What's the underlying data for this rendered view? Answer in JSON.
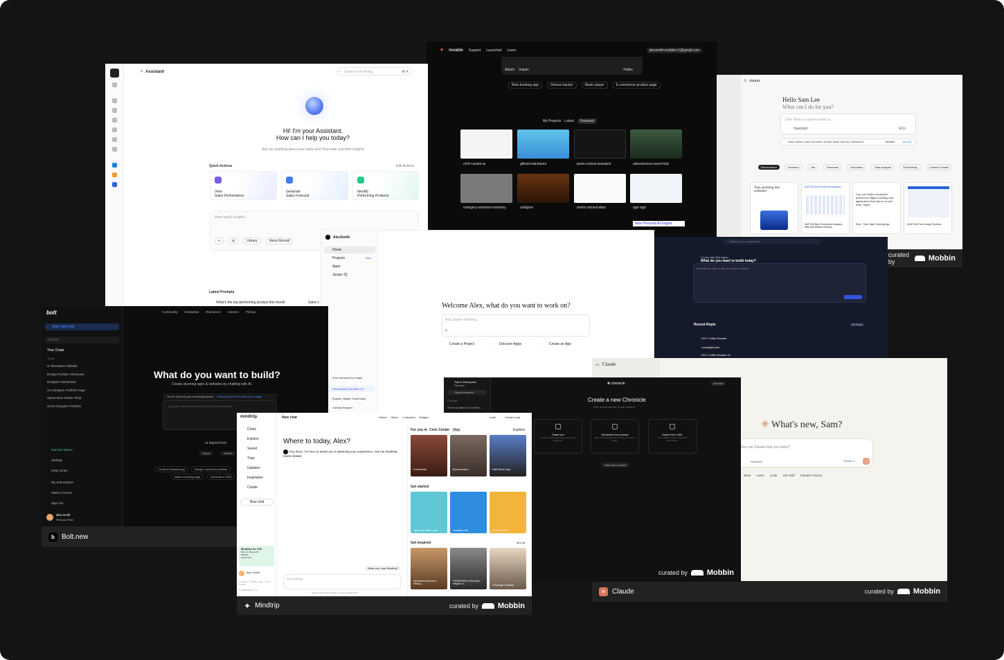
{
  "colors": {
    "frame": "#141414",
    "mobbin_bar": "#222222",
    "claude_accent": "#d97757",
    "bolt_blue": "#2d6de8"
  },
  "brand": {
    "mobbin": "Mobbin",
    "curated_by": "curated by",
    "curated_by_alt": "curated by"
  },
  "assistant": {
    "title": "Assistant",
    "search_placeholder": "Search everything...",
    "search_shortcut": "⌘ K",
    "heading": "Hi! I'm your Assistant.",
    "heading2": "How can I help you today?",
    "sub": "Ask me anything about your sales and I'll provide real-time insights",
    "quick_actions": "Quick Actions",
    "edit_actions": "Edit Actions",
    "cards": [
      {
        "l1": "View",
        "l2": "Sales Performance"
      },
      {
        "l1": "Generate",
        "l2": "Sales Forecast"
      },
      {
        "l1": "Identify",
        "l2": "Performing Products"
      }
    ],
    "input_placeholder": "Need quick insights...",
    "library": "Library",
    "voice": "Voice Record",
    "latest_prompts": "Latest Prompts",
    "prompt1": "What's the top-performing product this month",
    "prompt2": "Sales c"
  },
  "lovable": {
    "brand": "lovable",
    "nav": [
      "Support",
      "Launched",
      "Learn"
    ],
    "email": "alexsmith.mobbin+1@gmail.com",
    "attach": "Attach",
    "import": "Import",
    "public": "Public",
    "suggestions": [
      "Beta booking app",
      "Fitness tracker",
      "Music player",
      "E-commerce product page"
    ],
    "tabs": [
      "My Projects",
      "Latest",
      "Featured"
    ],
    "projects": [
      "chef-curator-ia",
      "github-hatchaven",
      "jarvis-voiced-assistant",
      "adventurous-resort-hub",
      "orangery-ventures-harmony",
      "undigmo",
      "metric-wizard-atlas",
      "agri-sign"
    ],
    "bottom_label": "New Personal AI Engine"
  },
  "manus": {
    "brand": "manus",
    "greeting": "Hello Sam Lee",
    "question": "What can I do for you?",
    "placeholder": "Give Manus a task to work on...",
    "standard": "Standard",
    "eco": "ECo",
    "suggestion": "Have Manus catch the plans at task starts and key milestones",
    "decline": "Decline",
    "accept": "Accept",
    "tabs": [
      "Recommend",
      "Featured",
      "Life",
      "Research",
      "Education",
      "Data Analysis",
      "Productivity",
      "Content Creator"
    ],
    "card1": "Turn anything into websites!",
    "card2_title": "S&P 500 Net Performers Analysis",
    "card3": "Can you build a beautiful interactive flight tracking web application that shows in real time, flight...",
    "card2_sub": "S&P 500 Best Performers Analysis - With and Without Outliers",
    "card3_sub": "Real - Time Flight Tracking App",
    "card4_sub": "MLB First Five Innings Predictor"
  },
  "jasper": {
    "user": "AlexSmith",
    "nav": [
      "Home",
      "Projects",
      "Apps",
      "Jasper IQ"
    ],
    "new_badge": "New",
    "welcome": "Welcome Alex, what do you want to work on?",
    "placeholder": "Ask Jasper anything...",
    "actions": [
      "Create a Project",
      "Discover Apps",
      "Create an App"
    ],
    "bottom": [
      "Free trial ends in 4 days",
      "Onboarding Checklist 0/4",
      "Explore Jasper Community",
      "Contact Support"
    ]
  },
  "boltdev": {
    "header": "Create with Bolt Agent",
    "question": "What do you want to build today?",
    "placeholder": "Describe an app or site you want to create...",
    "recent": "Recent Repls",
    "all_repls": "All Repls",
    "repls": [
      "NYC Coffee Roaster",
      "LandingRouter",
      "NYC Coffee Roaster v2"
    ],
    "search": "Search & run commands"
  },
  "bolt": {
    "brand": "bolt",
    "start_chat": "Start new chat",
    "search": "Search",
    "your_chats": "Your Chats",
    "today": "Today",
    "chats": [
      "UI Illustration Website",
      "Design Portfolio Showcase",
      "Designer Dashboard",
      "UX Designer Portfolio Page",
      "SpiceHome Online Shop",
      "UI/UX Designer Portfolio"
    ],
    "nav": [
      "Community",
      "Enterprise",
      "Resources",
      "Careers",
      "Pricing"
    ],
    "heading": "What do you want to build?",
    "sub": "Create stunning apps & websites by chatting with AI.",
    "tokens": "You've used all your remaining tokens.",
    "upgrade": "Subscribe to Pro for 66x more usage",
    "placeholder": "Type your idea and we'll bring it to life (or /command)",
    "import": "or import from",
    "figma": "Figma",
    "github": "GitHub",
    "pills": [
      "Create a financial app",
      "Design a directory website",
      "Make a landing page",
      "Generate a CRM"
    ],
    "menu": [
      "Get free tokens",
      "Settings",
      "Help Center",
      "My Subscription",
      "Select Account",
      "Sign Out"
    ],
    "user": "alex-smith",
    "plan": "Personal Plan",
    "caption": "Bolt.new"
  },
  "mindtrip": {
    "brand": "mindtrip.",
    "new_chat": "New chat",
    "nav": [
      "Chats",
      "Explore",
      "Saved",
      "Trips",
      "Updates",
      "Inspiration",
      "Create"
    ],
    "new_chat_btn": "New chat",
    "filters": [
      "Where",
      "When",
      "2 travelers",
      "Budget"
    ],
    "invite": "Invite",
    "create_trip": "Create a trip",
    "heading": "Where to today, Alex?",
    "message": "Hey there, I'm here to assist you in planning your experience. Ask me anything travel related.",
    "placeholder": "Ask anything...",
    "ask_suggest": "What can I ask Mindtrip?",
    "footer": "Mindtrip can make mistakes. Check important info.",
    "for_you": "For you in",
    "city": "Civic Center",
    "map": "Map",
    "explore": "Explore",
    "get_started": "Get started",
    "get_inspired": "Get inspired",
    "see_all": "See all",
    "places": [
      "Frenchette",
      "Bonaventure",
      "Half Moon Bay"
    ],
    "started": [
      "Take our travel quiz",
      "Create a trip",
      "Creator tools"
    ],
    "inspired": [
      "Marrakech Adventure, History,...",
      "FIREWORKS in Brooklyn Heights in...",
      "A Portugal Getaway"
    ],
    "ios_title": "Mindtrip for iOS",
    "ios_sub": "Plan on the go with Mindtrip",
    "learn_more": "Learn more",
    "user": "Alex Smith",
    "links": "Company · Contact · Help · Terms · Privacy",
    "copyright": "© 2025 Mindtrip, Inc.",
    "caption": "Mindtrip"
  },
  "chronicle": {
    "workspace": "Sam's Workspace",
    "plan": "Free plan",
    "new_doc": "New document",
    "favorites": "Favorites",
    "doc": "The Art & Science of UX Rese...",
    "brand": "chronicle",
    "free_trial": "Free trial",
    "heading": "Create a new Chronicle",
    "sub": "How would you like to get started?",
    "options": [
      {
        "t": "Paste text",
        "d": "Create by pasting existing notes from a document."
      },
      {
        "t": "Generate from prompt",
        "d": "Write a short description of what you want to create."
      },
      {
        "t": "Import from URL",
        "d": "Turn a website into an interactive presentation."
      }
    ],
    "scratch": "Start from scratch"
  },
  "claude": {
    "brand": "Claude",
    "heading": "What's new, Sam?",
    "placeholder": "How can Claude help you today?",
    "research": "Research",
    "model": "Sonnet 4",
    "chips": [
      "Write",
      "Learn",
      "Code",
      "Life stuff",
      "Claude's choice"
    ],
    "caption": "Claude"
  }
}
